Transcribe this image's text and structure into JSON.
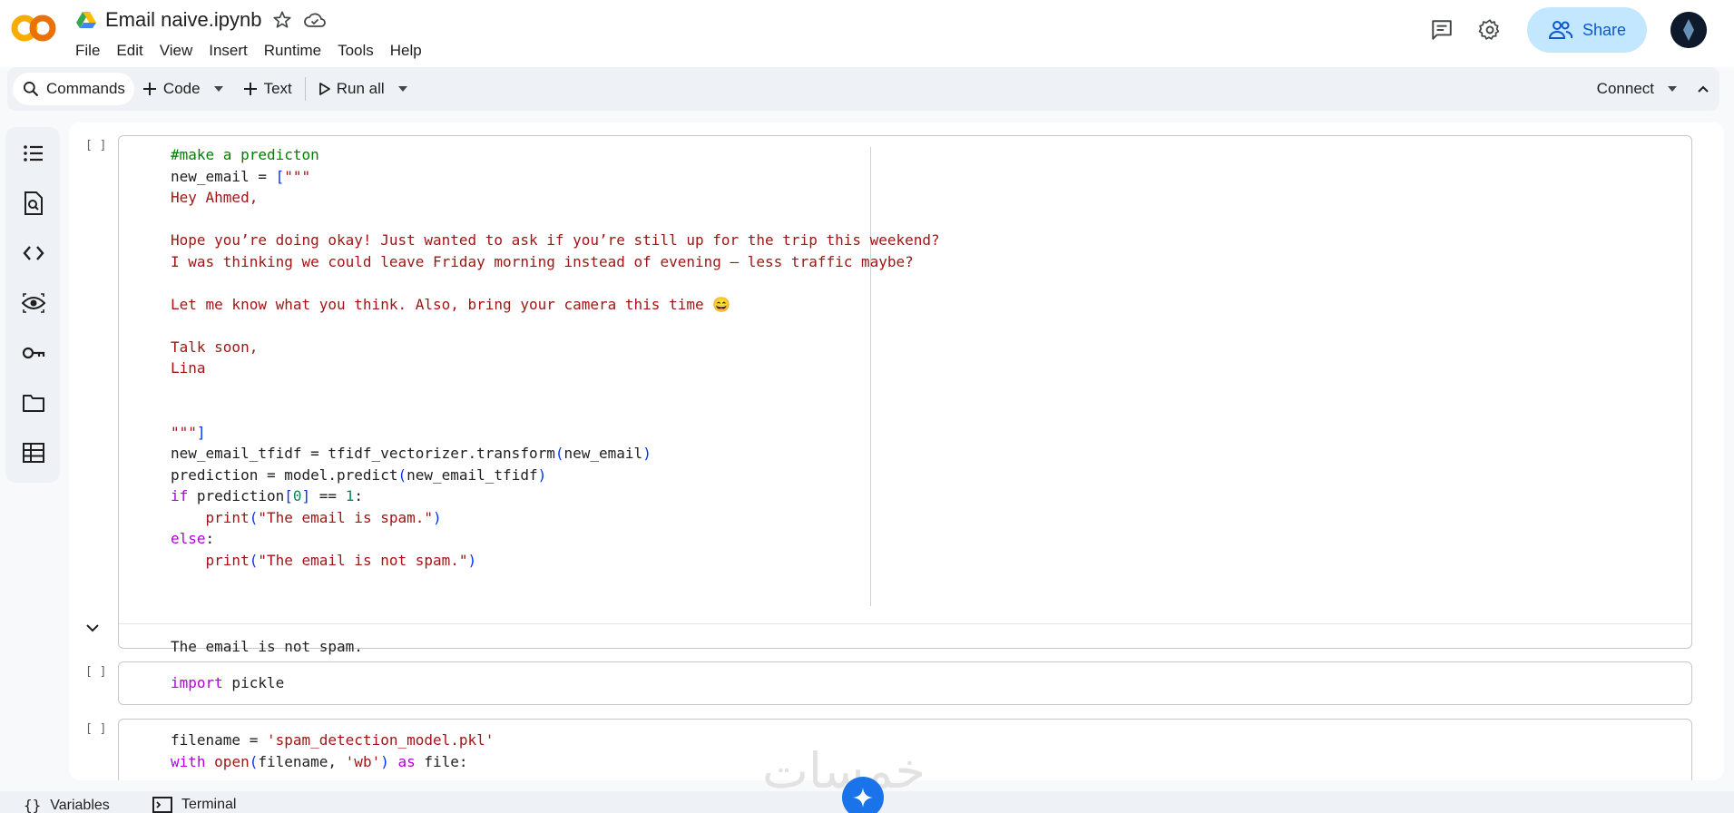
{
  "header": {
    "logo_text": "CO",
    "notebook_title": "Email naive.ipynb",
    "share_label": "Share"
  },
  "menu": [
    "File",
    "Edit",
    "View",
    "Insert",
    "Runtime",
    "Tools",
    "Help"
  ],
  "toolbar": {
    "commands_label": "Commands",
    "code_label": "Code",
    "text_label": "Text",
    "run_all_label": "Run all",
    "connect_label": "Connect"
  },
  "cells": [
    {
      "run_marker": "[ ]",
      "output": "The email is not spam."
    },
    {
      "run_marker": "[ ]"
    },
    {
      "run_marker": "[ ]"
    }
  ],
  "bottom_bar": {
    "variables_label": "Variables",
    "terminal_label": "Terminal"
  },
  "watermark": "خمسات",
  "colors": {
    "share_bg": "#c2e7ff",
    "share_text": "#0b57d0",
    "comment": "#008000",
    "string": "#a31515",
    "keyword": "#af00db",
    "number": "#098658"
  }
}
